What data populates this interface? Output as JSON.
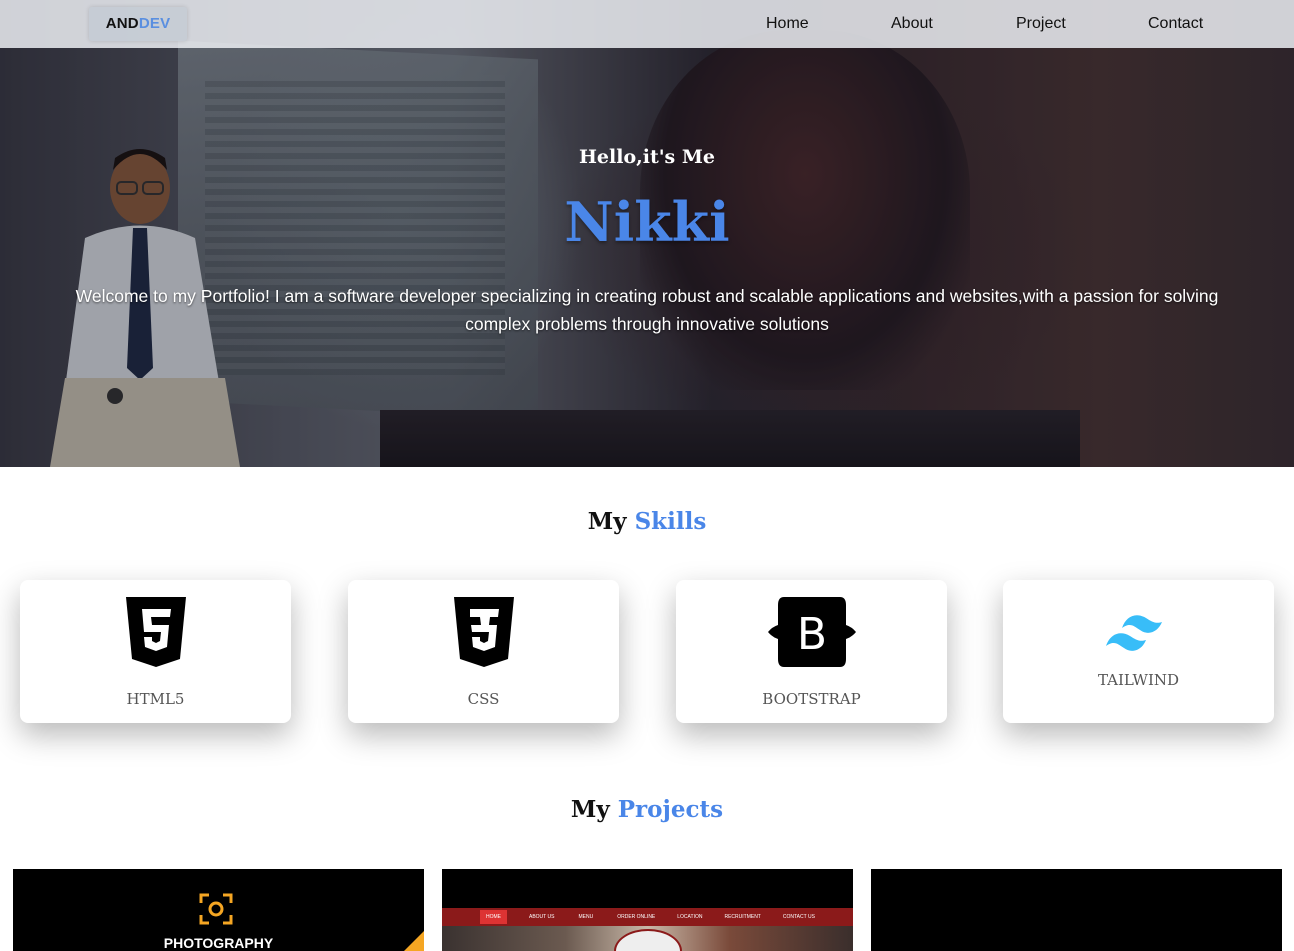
{
  "nav": {
    "logo_part1": "AND",
    "logo_part2": "DEV",
    "links": [
      "Home",
      "About",
      "Project",
      "Contact"
    ]
  },
  "hero": {
    "greeting": "Hello,it's Me",
    "name": "Nikki",
    "intro": "Welcome to my Portfolio! I am a software developer specializing in creating robust and scalable applications and websites,with a passion for solving complex problems through innovative solutions"
  },
  "skills": {
    "heading_part1": "My",
    "heading_part2": "Skills",
    "items": [
      {
        "label": "HTML5",
        "icon": "html5-icon"
      },
      {
        "label": "CSS",
        "icon": "css3-icon"
      },
      {
        "label": "BOOTSTRAP",
        "icon": "bootstrap-icon"
      },
      {
        "label": "TAILWIND",
        "icon": "tailwind-icon"
      }
    ]
  },
  "projects": {
    "heading_part1": "My",
    "heading_part2": "Projects",
    "items": [
      {
        "caption": "PHOTOGRAPHY",
        "icon": "camera-focus-icon"
      },
      {
        "nav_items": [
          "HOME",
          "ABOUT US",
          "MENU",
          "ORDER ONLINE",
          "LOCATION",
          "RECRUITMENT",
          "CONTACT US"
        ]
      },
      {}
    ]
  },
  "colors": {
    "accent": "#4a86e8",
    "tailwind": "#38bdf8",
    "photo_orange": "#f5a623"
  }
}
